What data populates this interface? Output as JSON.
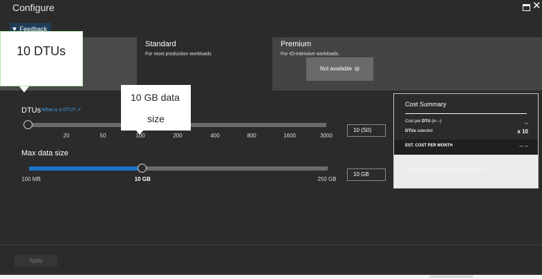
{
  "window": {
    "title": "Configure",
    "maximize_icon": "maximize-icon",
    "close_icon": "close-icon",
    "close_glyph": "✕"
  },
  "feedback": {
    "label": "Feedback",
    "icon": "heart-icon",
    "glyph": "♥"
  },
  "tiers": {
    "standard": {
      "name": "Standard",
      "desc": "For most production workloads"
    },
    "premium": {
      "name": "Premium",
      "desc": "For IO-intensive workloads.",
      "button": "Not available",
      "info_glyph": "i"
    }
  },
  "callouts": {
    "dtu": "10 DTUs",
    "size_line1": "10 GB data",
    "size_line2": "size"
  },
  "dtu": {
    "label": "DTUs",
    "link": "What is a DTU? ↗",
    "ticks": [
      "20",
      "50",
      "100",
      "200",
      "400",
      "800",
      "1600",
      "3000"
    ],
    "value": "10 (S0)",
    "level": 0
  },
  "max_size": {
    "label": "Max data size",
    "min": "100 MB",
    "selected": "10 GB",
    "max": "250 GB",
    "value": "10 GB",
    "level": 0.38
  },
  "cost_summary": {
    "title": "Cost Summary",
    "rows": [
      {
        "label_prefix": "Cost per ",
        "label_bold": "DTU",
        "label_suffix": " (in --)",
        "value": "--"
      },
      {
        "label_prefix": "",
        "label_bold": "DTUs",
        "label_suffix": " selected",
        "value": "x 10"
      }
    ],
    "est_label": "EST. COST PER MONTH",
    "est_value": "-- --",
    "footer": "PRICING CONTACT YOUR RESELLER"
  },
  "apply": {
    "label": "Apply"
  },
  "colors": {
    "background": "#2b2b2b",
    "accent": "#1e73c6",
    "link": "#3f9ee8"
  }
}
